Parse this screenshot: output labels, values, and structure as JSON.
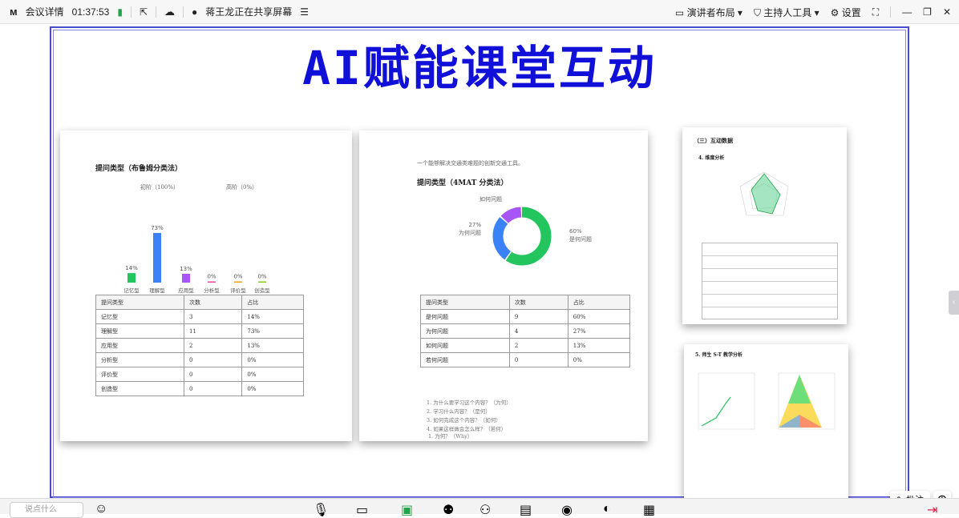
{
  "topbar": {
    "meeting_details": "会议详情",
    "timer": "01:37:53",
    "sharing_status": "蒋王龙正在共享屏幕",
    "layout_label": "演讲者布局",
    "host_tools_label": "主持人工具",
    "settings_label": "设置"
  },
  "slide": {
    "title": "AI赋能课堂互动"
  },
  "page1": {
    "heading": "提问类型（布鲁姆分类法）",
    "chart_group_left": "初阶（100%）",
    "chart_group_right": "高阶（0%）",
    "table": {
      "headers": [
        "提问类型",
        "次数",
        "占比"
      ],
      "rows": [
        [
          "记忆型",
          "3",
          "14%"
        ],
        [
          "理解型",
          "11",
          "73%"
        ],
        [
          "应用型",
          "2",
          "13%"
        ],
        [
          "分析型",
          "0",
          "0%"
        ],
        [
          "评价型",
          "0",
          "0%"
        ],
        [
          "创造型",
          "0",
          "0%"
        ]
      ]
    }
  },
  "page2": {
    "top_line": "一个能够解决交通类难题的创新交通工具。",
    "heading": "提问类型（4MAT 分类法）",
    "table": {
      "headers": [
        "提问类型",
        "次数",
        "占比"
      ],
      "rows": [
        [
          "是何问题",
          "9",
          "60%"
        ],
        [
          "为何问题",
          "4",
          "27%"
        ],
        [
          "如何问题",
          "2",
          "13%"
        ],
        [
          "若何问题",
          "0",
          "0%"
        ]
      ]
    },
    "notes": [
      "1. 为什么要学习这个内容？（为何）",
      "2. 学习什么内容？（是何）",
      "3. 如何完成这个内容？（如何）",
      "4. 如果这样做会怎么样？（若何）"
    ],
    "bottom_line": "1. 为何？（Why）"
  },
  "page3": {
    "heading": "（三）互动数据",
    "subheading": "4. 维度分析"
  },
  "page4": {
    "heading": "5. 师生 S-T 教学分析"
  },
  "chart_data": [
    {
      "type": "bar",
      "categories": [
        "记忆型",
        "理解型",
        "应用型",
        "分析型",
        "评价型",
        "创造型"
      ],
      "values": [
        14,
        73,
        13,
        0,
        0,
        0
      ],
      "value_labels": [
        "14%",
        "73%",
        "13%",
        "0%",
        "0%",
        "0%"
      ],
      "colors": [
        "#22c55e",
        "#3b82f6",
        "#a855f7",
        "#ec4899",
        "#f59e0b",
        "#84cc16"
      ],
      "ylim": [
        0,
        100
      ]
    },
    {
      "type": "pie",
      "labels": [
        "是何问题",
        "为何问题",
        "如何问题"
      ],
      "values": [
        60,
        27,
        13
      ],
      "value_labels": [
        "60%",
        "27%",
        "13%"
      ],
      "colors": [
        "#22c55e",
        "#3b82f6",
        "#a855f7"
      ]
    }
  ],
  "tools": {
    "annotate_label": "批注",
    "input_placeholder": "说点什么"
  }
}
